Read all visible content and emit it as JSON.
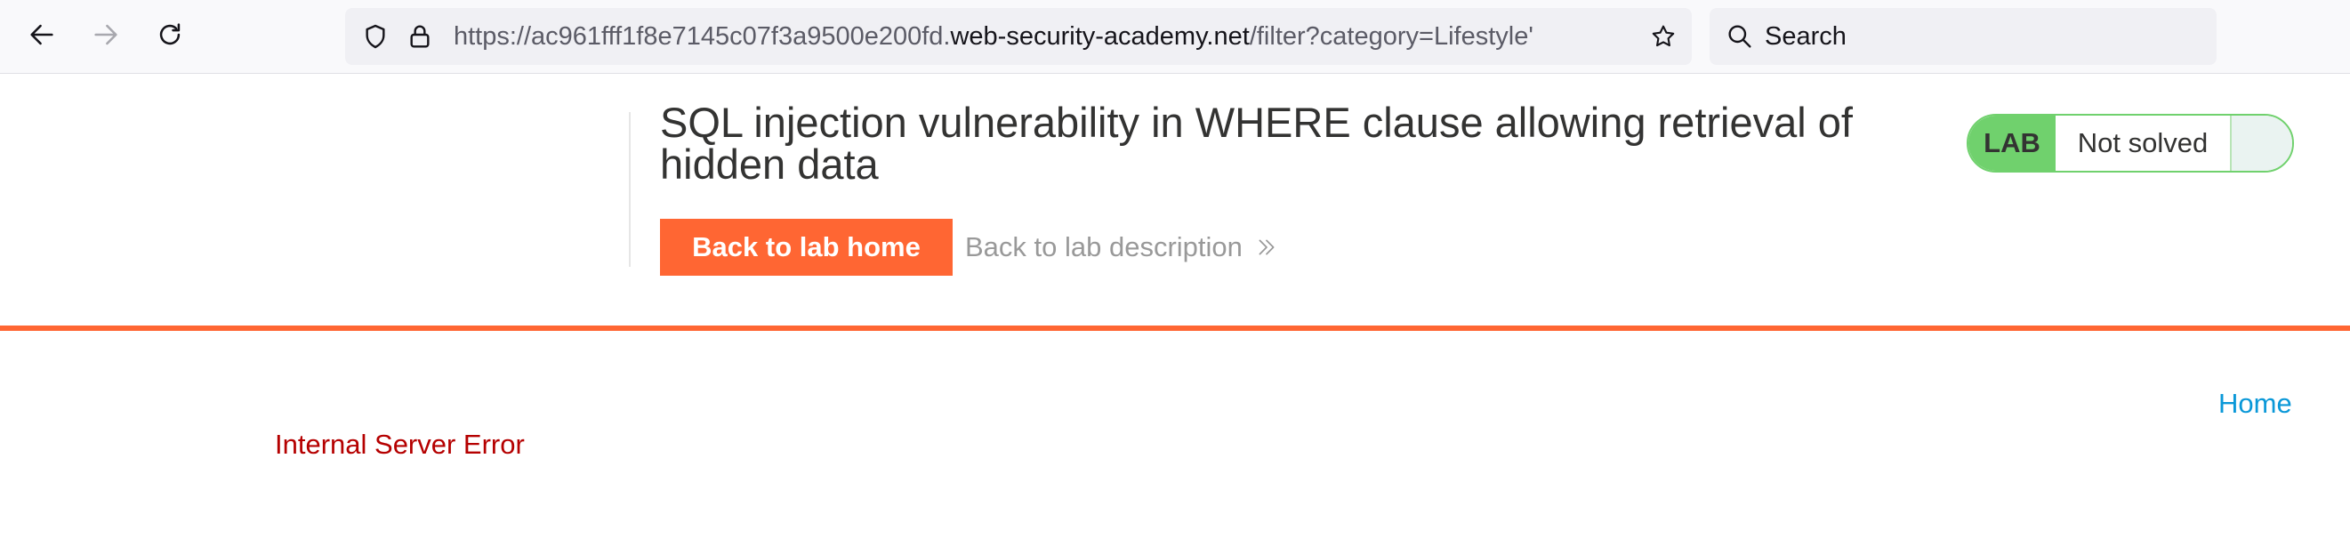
{
  "browser": {
    "url_prefix": "https://ac961fff1f8e7145c07f3a9500e200fd.",
    "url_host": "web-security-academy.net",
    "url_path": "/filter?category=Lifestyle'",
    "search_placeholder": "Search",
    "icons": [
      "back-arrow-icon",
      "forward-arrow-icon",
      "reload-icon",
      "shield-icon",
      "lock-icon",
      "star-icon",
      "search-icon"
    ]
  },
  "lab": {
    "title": "SQL injection vulnerability in WHERE clause allowing retrieval of hidden data",
    "back_home_label": "Back to lab home",
    "back_desc_label": "Back to lab description",
    "badge_label": "LAB",
    "status_label": "Not solved"
  },
  "page": {
    "home_link": "Home",
    "error_message": "Internal Server Error"
  },
  "colors": {
    "accent": "#ff6633",
    "status_green": "#70d16d",
    "error": "#b50000",
    "link": "#0a98d8"
  }
}
